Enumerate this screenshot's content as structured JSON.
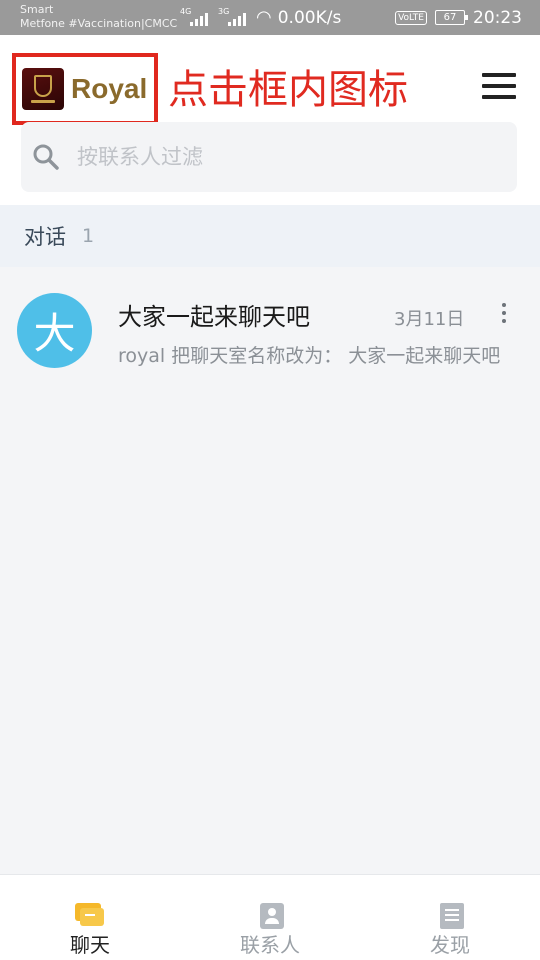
{
  "status_bar": {
    "carrier_line1": "Smart",
    "carrier_line2": "Metfone #Vaccination|CMCC",
    "signal1_label": "4G",
    "signal2_label": "3G",
    "net_speed": "0.00K/s",
    "volte": "VoLTE",
    "battery": "67",
    "time": "20:23"
  },
  "header": {
    "brand_name": "Royal",
    "annotation": "点击框内图标",
    "search_placeholder": "按联系人过滤"
  },
  "section": {
    "title": "对话",
    "count": "1"
  },
  "chats": [
    {
      "avatar_text": "大",
      "avatar_color": "#4fbfe8",
      "title": "大家一起来聊天吧",
      "date": "3月11日",
      "preview": "royal 把聊天室名称改为： 大家一起来聊天吧"
    }
  ],
  "bottom_nav": [
    {
      "label": "聊天",
      "icon": "chat-bubbles-icon",
      "active": true
    },
    {
      "label": "联系人",
      "icon": "contacts-book-icon",
      "active": false
    },
    {
      "label": "发现",
      "icon": "discover-doc-icon",
      "active": false
    }
  ],
  "colors": {
    "annotation_red": "#e0281e",
    "brand_gold": "#8a6a2c",
    "active_tab_yellow": "#f5b82a"
  }
}
